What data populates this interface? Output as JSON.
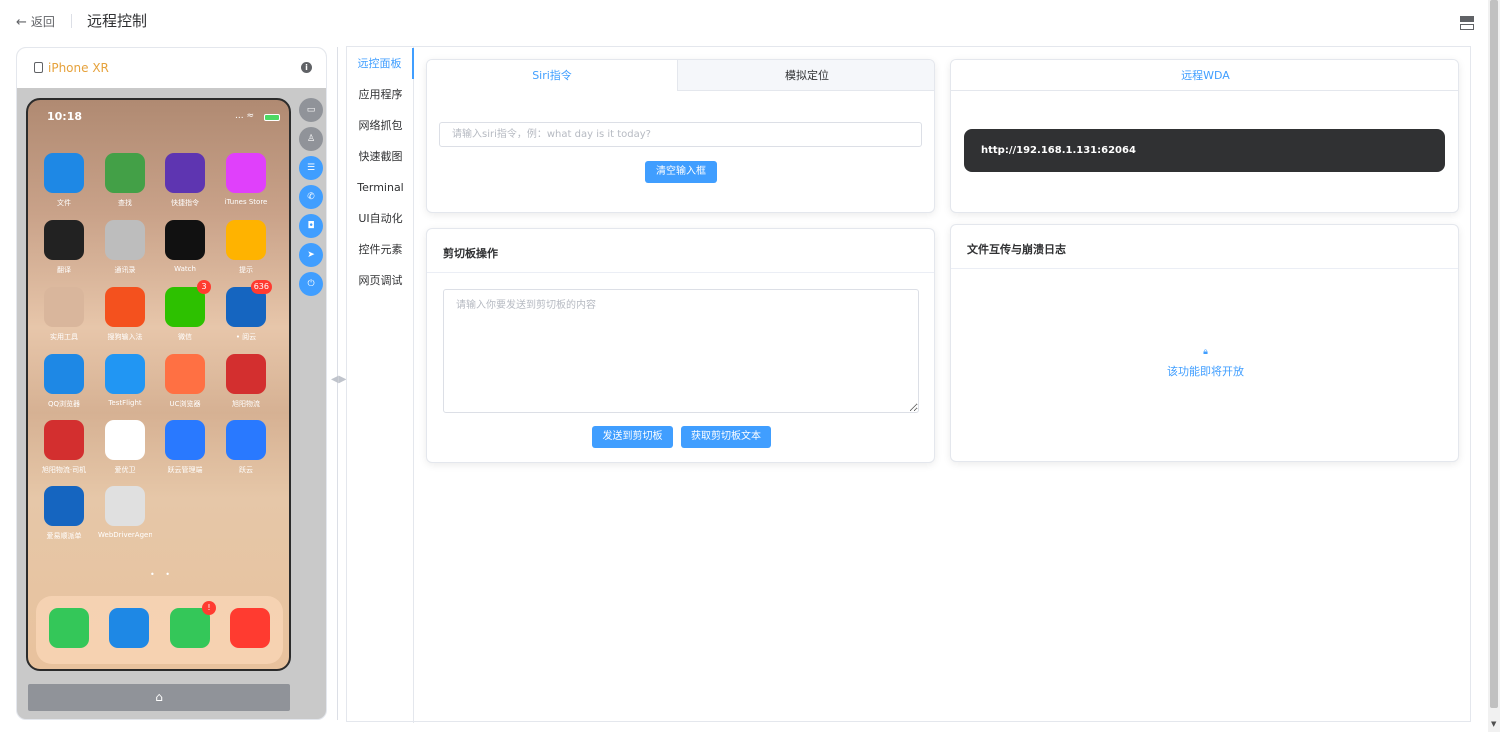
{
  "header": {
    "back_label": "返回",
    "title": "远程控制"
  },
  "device": {
    "name": "iPhone XR",
    "time": "10:18",
    "status": "... ≈",
    "apps": [
      {
        "label": "文件",
        "color": "#1e88e5",
        "icon": "folder-icon"
      },
      {
        "label": "查找",
        "color": "#43a047",
        "icon": "findmy-icon"
      },
      {
        "label": "快捷指令",
        "color": "#5e35b1",
        "icon": "shortcuts-icon"
      },
      {
        "label": "iTunes Store",
        "color": "#e040fb",
        "icon": "star-icon"
      },
      {
        "label": "翻译",
        "color": "#222222",
        "icon": "translate-icon"
      },
      {
        "label": "通讯录",
        "color": "#bdbdbd",
        "icon": "contacts-icon"
      },
      {
        "label": "Watch",
        "color": "#111111",
        "icon": "watch-icon"
      },
      {
        "label": "提示",
        "color": "#ffb300",
        "icon": "bulb-icon"
      },
      {
        "label": "实用工具",
        "color": "#d9b69c",
        "icon": "folder-group-icon"
      },
      {
        "label": "搜狗输入法",
        "color": "#f4511e",
        "icon": "sogou-icon"
      },
      {
        "label": "微信",
        "color": "#2dc100",
        "icon": "wechat-icon",
        "badge": "3"
      },
      {
        "label": "• 阅云",
        "color": "#1565c0",
        "icon": "yueyun-icon",
        "badge": "636"
      },
      {
        "label": "QQ浏览器",
        "color": "#1e88e5",
        "icon": "qq-browser-icon"
      },
      {
        "label": "TestFlight",
        "color": "#2196f3",
        "icon": "testflight-icon"
      },
      {
        "label": "UC浏览器",
        "color": "#ff7043",
        "icon": "uc-browser-icon"
      },
      {
        "label": "旭阳物流",
        "color": "#d32f2f",
        "icon": "xuyang-icon"
      },
      {
        "label": "旭阳物流·司机",
        "color": "#d32f2f",
        "icon": "xuyang-driver-icon"
      },
      {
        "label": "爱优卫",
        "color": "#ffffff",
        "icon": "auv-icon"
      },
      {
        "label": "跃云管理端",
        "color": "#2979ff",
        "icon": "yueyun-admin-icon"
      },
      {
        "label": "跃云",
        "color": "#2979ff",
        "icon": "yueyun-app-icon"
      },
      {
        "label": "爱易顺派单",
        "color": "#1565c0",
        "icon": "aiyishun-icon"
      },
      {
        "label": "WebDriverAgen...",
        "color": "#e0e0e0",
        "icon": "webdriveragent-icon"
      }
    ],
    "dock": [
      {
        "icon": "phone-icon",
        "color": "#34c759"
      },
      {
        "icon": "safari-icon",
        "color": "#1e88e5"
      },
      {
        "icon": "messages-icon",
        "color": "#34c759",
        "badge": "!"
      },
      {
        "icon": "music-icon",
        "color": "#ff3b30"
      }
    ],
    "side_buttons": [
      {
        "icon": "record-icon",
        "color": "#909399",
        "glyph": "▭"
      },
      {
        "icon": "person-icon",
        "color": "#909399",
        "glyph": "♙"
      },
      {
        "icon": "settings-icon",
        "color": "#409eff",
        "glyph": "☰"
      },
      {
        "icon": "phone-call-icon",
        "color": "#409eff",
        "glyph": "✆"
      },
      {
        "icon": "camera-icon",
        "color": "#409eff",
        "glyph": "◘"
      },
      {
        "icon": "location-icon",
        "color": "#409eff",
        "glyph": "➤"
      },
      {
        "icon": "power-icon",
        "color": "#409eff",
        "glyph": "⏻"
      }
    ],
    "home_glyph": "⌂"
  },
  "nav": {
    "tabs": [
      "远控面板",
      "应用程序",
      "网络抓包",
      "快速截图",
      "Terminal",
      "UI自动化",
      "控件元素",
      "网页调试"
    ],
    "active": 0
  },
  "siri_card": {
    "tabs": [
      "Siri指令",
      "模拟定位"
    ],
    "placeholder": "请输入siri指令，例：what day is it today?",
    "clear_button": "清空输入框"
  },
  "wda_card": {
    "tab": "远程WDA",
    "url": "http://192.168.1.131:62064"
  },
  "clipboard_card": {
    "title": "剪切板操作",
    "placeholder": "请输入你要发送到剪切板的内容",
    "send_button": "发送到剪切板",
    "get_button": "获取剪切板文本"
  },
  "file_card": {
    "title": "文件互传与崩溃日志",
    "notice": "该功能即将开放"
  },
  "colors": {
    "accent": "#409eff",
    "warning": "#e6a23c"
  }
}
